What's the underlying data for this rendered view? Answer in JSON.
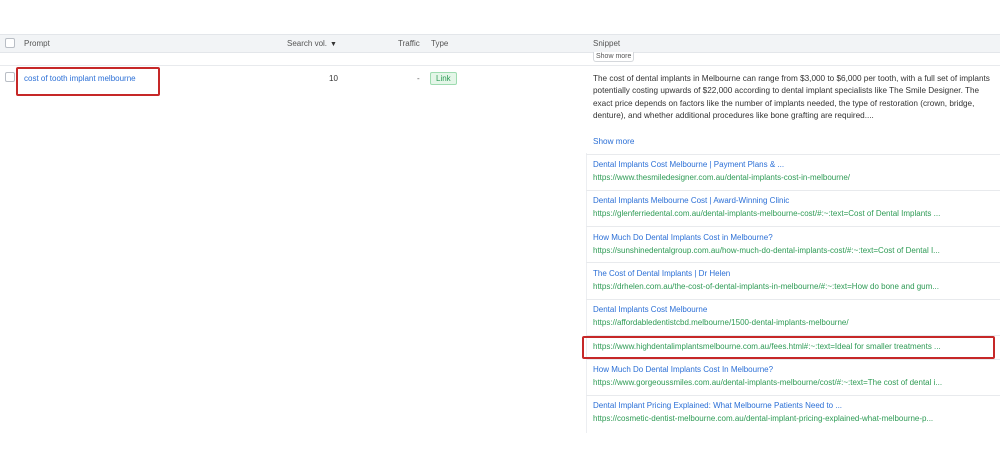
{
  "header": {
    "prompt": "Prompt",
    "search_vol": "Search vol.",
    "sort_icon": "caret-down-icon",
    "traffic": "Traffic",
    "type": "Type",
    "snippet": "Snippet"
  },
  "top_show_more": "Show more",
  "row": {
    "prompt": "cost of tooth implant melbourne",
    "search_vol": "10",
    "traffic": "-",
    "type": "Link",
    "snippet": "The cost of dental implants in Melbourne can range from $3,000 to $6,000 per tooth, with a full set of implants potentially costing upwards of $22,000 according to dental implant specialists like The Smile Designer. The exact price depends on factors like the number of implants needed, the type of restoration (crown, bridge, denture), and whether additional procedures like bone grafting are required....",
    "show_more": "Show more"
  },
  "results": [
    {
      "title": "Dental Implants Cost Melbourne | Payment Plans & ...",
      "url": "https://www.thesmiledesigner.com.au/dental-implants-cost-in-melbourne/"
    },
    {
      "title": "Dental Implants Melbourne Cost | Award-Winning Clinic",
      "url": "https://glenferriedental.com.au/dental-implants-melbourne-cost/#:~:text=Cost of Dental Implants ..."
    },
    {
      "title": "How Much Do Dental Implants Cost in Melbourne?",
      "url": "https://sunshinedentalgroup.com.au/how-much-do-dental-implants-cost/#:~:text=Cost of Dental I..."
    },
    {
      "title": "The Cost of Dental Implants | Dr Helen",
      "url": "https://drhelen.com.au/the-cost-of-dental-implants-in-melbourne/#:~:text=How do bone and gum..."
    },
    {
      "title": "Dental Implants Cost Melbourne",
      "url": "https://affordabledentistcbd.melbourne/1500-dental-implants-melbourne/"
    },
    {
      "title": "",
      "url": "https://www.highdentalimplantsmelbourne.com.au/fees.html#:~:text=Ideal for smaller treatments ..."
    },
    {
      "title": "How Much Do Dental Implants Cost In Melbourne?",
      "url": "https://www.gorgeoussmiles.com.au/dental-implants-melbourne/cost/#:~:text=The cost of dental i..."
    },
    {
      "title": "Dental Implant Pricing Explained: What Melbourne Patients Need to ...",
      "url": "https://cosmetic-dentist-melbourne.com.au/dental-implant-pricing-explained-what-melbourne-p..."
    }
  ]
}
